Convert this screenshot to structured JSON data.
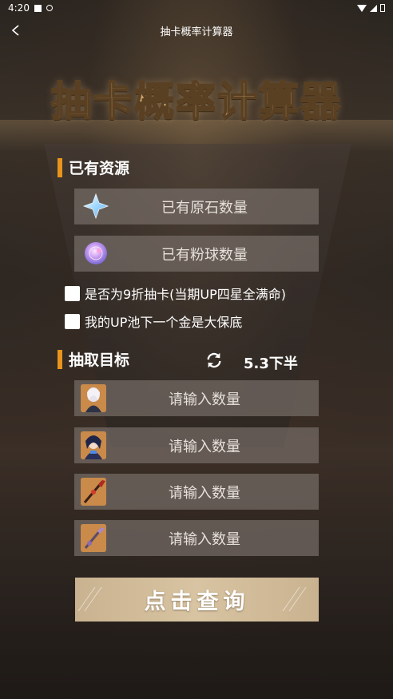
{
  "status_bar": {
    "time": "4:20"
  },
  "app_bar": {
    "title": "抽卡概率计算器"
  },
  "banner": {
    "title": "抽卡概率计算器"
  },
  "resources": {
    "section_title": "已有资源",
    "primogem_placeholder": "已有原石数量",
    "pink_ball_placeholder": "已有粉球数量"
  },
  "options": {
    "discount_label": "是否为9折抽卡(当期UP四星全满命)",
    "guarantee_label": "我的UP池下一个金是大保底"
  },
  "targets": {
    "section_title": "抽取目标",
    "version": "5.3下半",
    "inputs": [
      {
        "placeholder": "请输入数量",
        "icon": "character-1-avatar"
      },
      {
        "placeholder": "请输入数量",
        "icon": "character-2-avatar"
      },
      {
        "placeholder": "请输入数量",
        "icon": "weapon-polearm-icon"
      },
      {
        "placeholder": "请输入数量",
        "icon": "weapon-catalyst-icon"
      }
    ]
  },
  "query_button": {
    "label": "点击查询"
  },
  "colors": {
    "accent": "#e8951c",
    "button": "#d8c4a2",
    "input_bg": "#766c66"
  }
}
